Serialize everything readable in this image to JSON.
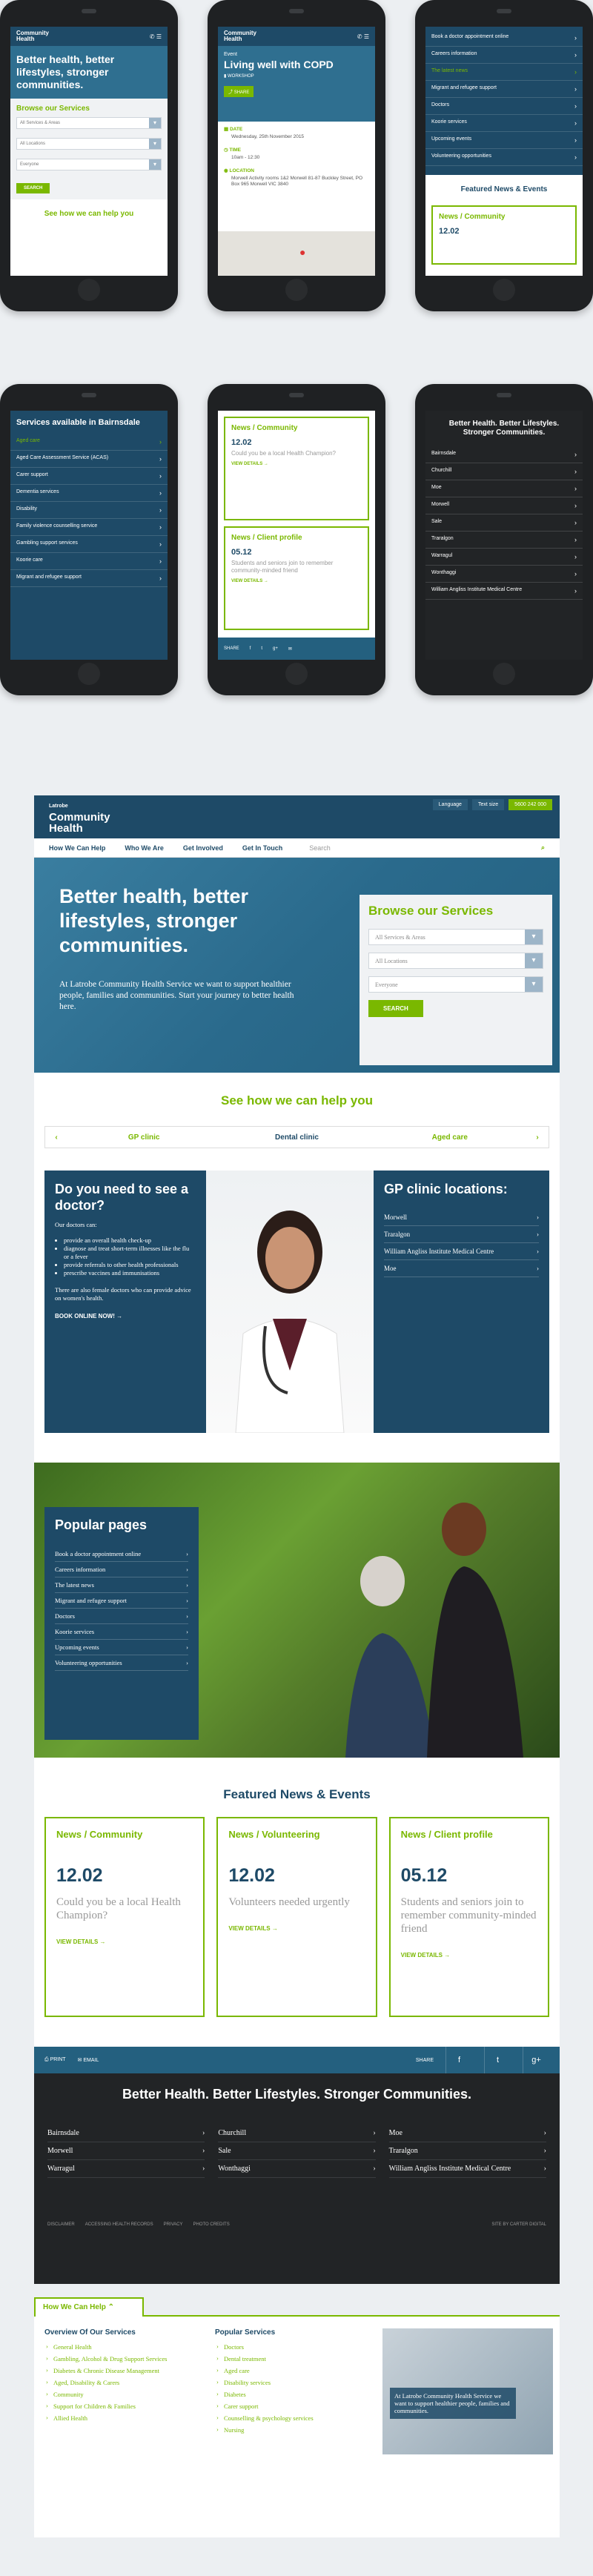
{
  "brand": {
    "name_line1": "Community",
    "name_line2": "Health",
    "prefix": "Latrobe",
    "accent": "#7ab800",
    "primary": "#1e4a67"
  },
  "phone1": {
    "hero": "Better health, better lifestyles, stronger communities.",
    "browse_title": "Browse our Services",
    "selects": [
      "All Services & Areas",
      "All Locations",
      "Everyone"
    ],
    "search_btn": "SEARCH",
    "help_link": "See how we can help you"
  },
  "phone2": {
    "label": "Event",
    "title": "Living well with COPD",
    "type": "WORKSHOP",
    "share": "SHARE",
    "date_label": "DATE",
    "date": "Wednesday, 25th November 2015",
    "time_label": "TIME",
    "time": "10am - 12:30",
    "location_label": "LOCATION",
    "location": "Morwell Activity rooms 1&2 Morwell 81-87 Buckley Street, PO Box 965 Morwell VIC 3840"
  },
  "phone3": {
    "items": [
      "Book a doctor appointment online",
      "Careers information",
      "The latest news",
      "Migrant and refugee support",
      "Doctors",
      "Koorie services",
      "Upcoming events",
      "Volunteering opportunities"
    ],
    "featured": "Featured News & Events",
    "card_title": "News / Community",
    "card_date": "12.02"
  },
  "phone4": {
    "title": "Services available in Bairnsdale",
    "items": [
      "Aged care",
      "Aged Care Assessment Service (ACAS)",
      "Carer support",
      "Dementia services",
      "Disability",
      "Family violence counselling service",
      "Gambling support services",
      "Koorie care",
      "Migrant and refugee support"
    ]
  },
  "phone5": {
    "cards": [
      {
        "title": "News / Community",
        "date": "12.02",
        "text": "Could you be a local Health Champion?",
        "link": "VIEW DETAILS"
      },
      {
        "title": "News / Client profile",
        "date": "05.12",
        "text": "Students and seniors join to remember community-minded friend",
        "link": "VIEW DETAILS"
      }
    ],
    "share": "SHARE"
  },
  "phone6": {
    "title": "Better Health. Better Lifestyles. Stronger Communities.",
    "items": [
      "Bairnsdale",
      "Churchill",
      "Moe",
      "Morwell",
      "Sale",
      "Traralgon",
      "Warragul",
      "Wonthaggi",
      "William Angliss Institute Medical Centre"
    ]
  },
  "desktop": {
    "top": {
      "language": "Language",
      "text_size": "Text size",
      "phone": "5600 242 000"
    },
    "nav": [
      "How We Can Help",
      "Who We Are",
      "Get Involved",
      "Get In Touch"
    ],
    "search_placeholder": "Search",
    "hero_title": "Better health, better lifestyles, stronger communities.",
    "hero_text": "At Latrobe Community Health Service we want to support healthier people, families and communities. Start your journey to better health here.",
    "browse_title": "Browse our Services",
    "selects": [
      "All Services & Areas",
      "All Locations",
      "Everyone"
    ],
    "search_btn": "SEARCH",
    "help_heading": "See how we can help you",
    "tabs": [
      "GP clinic",
      "Dental clinic",
      "Aged care"
    ],
    "doctor": {
      "title": "Do you need to see a doctor?",
      "intro": "Our doctors can:",
      "bullets": [
        "provide an overall health check-up",
        "diagnose and treat short-term illnesses like the flu or a fever",
        "provide referrals to other health professionals",
        "prescribe vaccines and immunisations"
      ],
      "note": "There are also female doctors who can provide advice on women's health.",
      "cta": "BOOK ONLINE NOW!"
    },
    "gp": {
      "title": "GP clinic locations:",
      "items": [
        "Morwell",
        "Traralgon",
        "William Angliss Institute Medical Centre",
        "Moe"
      ]
    },
    "popular": {
      "title": "Popular pages",
      "items": [
        "Book a doctor appointment online",
        "Careers information",
        "The latest news",
        "Migrant and refugee support",
        "Doctors",
        "Koorie services",
        "Upcoming events",
        "Volunteering opportunities"
      ]
    },
    "featured_heading": "Featured News & Events",
    "cards": [
      {
        "title": "News / Community",
        "date": "12.02",
        "text": "Could you be a local Health Champion?",
        "link": "VIEW DETAILS"
      },
      {
        "title": "News / Volunteering",
        "date": "12.02",
        "text": "Volunteers needed urgently",
        "link": "VIEW DETAILS"
      },
      {
        "title": "News / Client profile",
        "date": "05.12",
        "text": "Students and seniors join to remember community-minded friend",
        "link": "VIEW DETAILS"
      }
    ],
    "share_bar": {
      "print": "PRINT",
      "email": "EMAIL",
      "share": "SHARE"
    },
    "footer": {
      "title": "Better Health. Better Lifestyles. Stronger Communities.",
      "cols": [
        [
          "Bairnsdale",
          "Morwell",
          "Warragul"
        ],
        [
          "Churchill",
          "Sale",
          "Wonthaggi"
        ],
        [
          "Moe",
          "Traralgon",
          "William Angliss Institute Medical Centre"
        ]
      ],
      "legal": [
        "DISCLAIMER",
        "ACCESSING HEALTH RECORDS",
        "PRIVACY",
        "PHOTO CREDITS"
      ],
      "credit": "SITE BY CARTER DIGITAL"
    }
  },
  "mega": {
    "tab": "How We Can Help",
    "overview_title": "Overview Of Our Services",
    "overview": [
      "General Health",
      "Gambling, Alcohol & Drug Support Services",
      "Diabetes & Chronic Disease Management",
      "Aged, Disability & Carers",
      "Community",
      "Support for Children & Families",
      "Allied Health"
    ],
    "popular_title": "Popular Services",
    "popular": [
      "Doctors",
      "Dental treatment",
      "Aged care",
      "Disability services",
      "Diabetes",
      "Carer support",
      "Counselling & psychology services",
      "Nursing"
    ],
    "promo": "At Latrobe Community Health Service we want to support healthier people, families and communities."
  }
}
